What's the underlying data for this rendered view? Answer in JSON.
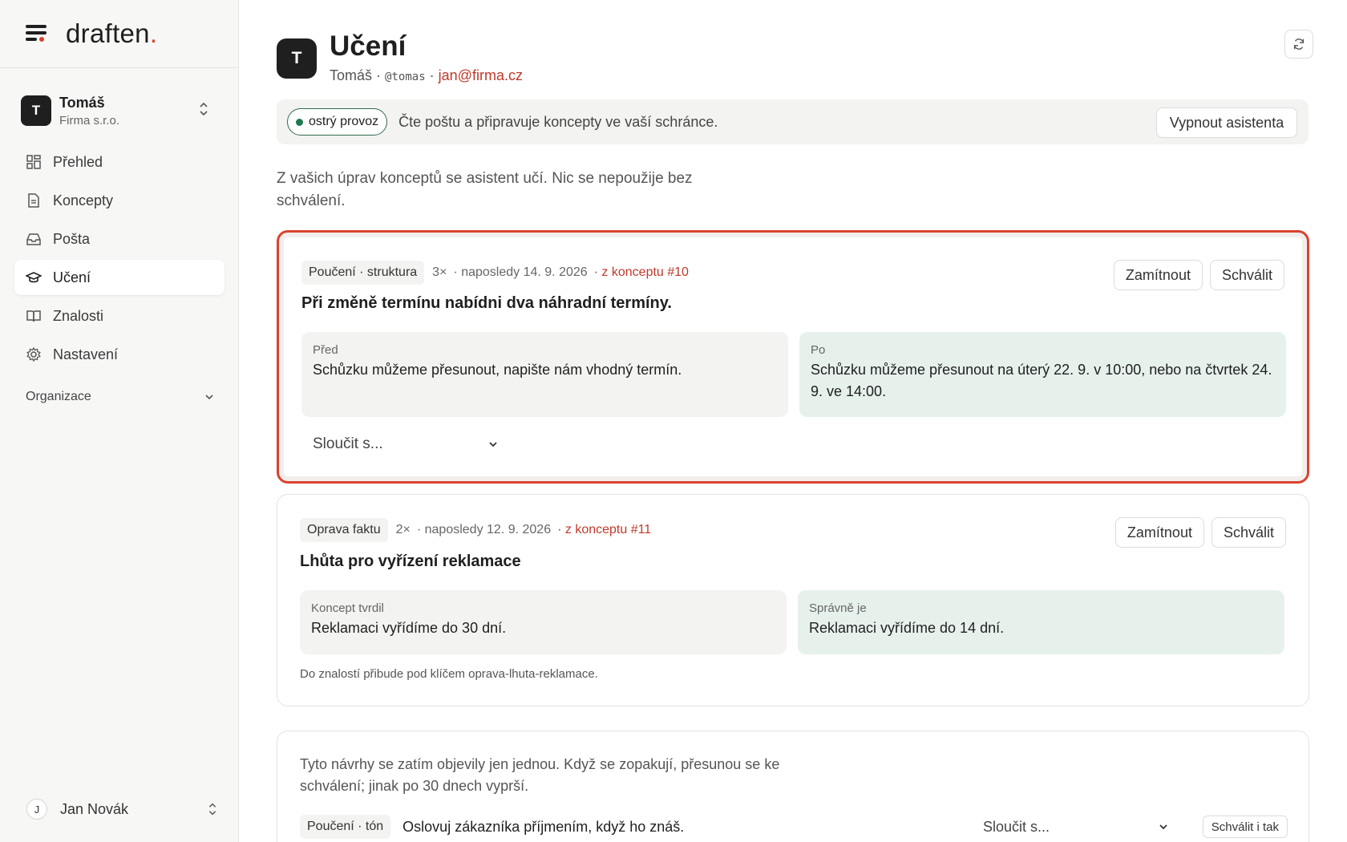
{
  "brand": {
    "name": "draften",
    "dot": "."
  },
  "account": {
    "initial": "T",
    "name": "Tomáš",
    "org": "Firma s.r.o."
  },
  "nav": {
    "items": [
      {
        "label": "Přehled",
        "icon": "grid-icon"
      },
      {
        "label": "Koncepty",
        "icon": "document-icon"
      },
      {
        "label": "Pošta",
        "icon": "inbox-icon"
      },
      {
        "label": "Učení",
        "icon": "graduation-cap-icon",
        "active": true
      },
      {
        "label": "Znalosti",
        "icon": "book-icon"
      },
      {
        "label": "Nastavení",
        "icon": "gear-icon"
      }
    ],
    "org_section": "Organizace"
  },
  "user": {
    "initial": "J",
    "name": "Jan Novák"
  },
  "header": {
    "initial": "T",
    "title": "Učení",
    "name": "Tomáš",
    "separator": "·",
    "handle": "@tomas",
    "email": "jan@firma.cz"
  },
  "status": {
    "pill": "ostrý provoz",
    "text": "Čte poštu a připravuje koncepty ve vaší schránce.",
    "disable_label": "Vypnout asistenta"
  },
  "intro": "Z vašich úprav konceptů se asistent učí. Nic se nepoužije bez schválení.",
  "cards": [
    {
      "tag": "Poučení · struktura",
      "count": "3×",
      "date": "· naposledy 14. 9. 2026",
      "source": "· z konceptu #10",
      "reject_label": "Zamítnout",
      "approve_label": "Schválit",
      "title": "Při změně termínu nabídni dva náhradní termíny.",
      "before_label": "Před",
      "before_text": "Schůzku můžeme přesunout, napište nám vhodný termín.",
      "after_label": "Po",
      "after_text": "Schůzku můžeme přesunout na úterý 22. 9. v 10:00, nebo na čtvrtek 24. 9. ve 14:00.",
      "merge_placeholder": "Sloučit s..."
    },
    {
      "tag": "Oprava faktu",
      "count": "2×",
      "date": "· naposledy 12. 9. 2026",
      "source": "· z konceptu #11",
      "reject_label": "Zamítnout",
      "approve_label": "Schválit",
      "title": "Lhůta pro vyřízení reklamace",
      "before_label": "Koncept tvrdil",
      "before_text": "Reklamaci vyřídíme do 30 dní.",
      "after_label": "Správně je",
      "after_text": "Reklamaci vyřídíme do 14 dní.",
      "note": "Do znalostí přibude pod klíčem oprava-lhuta-reklamace."
    }
  ],
  "pending": {
    "text": "Tyto návrhy se zatím objevily jen jednou. Když se zopakují, přesunou se ke schválení; jinak po 30 dnech vyprší.",
    "tag": "Poučení · tón",
    "item_text": "Oslovuj zákazníka příjmením, když ho znáš.",
    "merge_placeholder": "Sloučit s...",
    "approve_anyway_label": "Schválit i tak"
  },
  "colors": {
    "accent": "#d9432f",
    "link": "#c0392b",
    "live": "#1f7a4d",
    "after_bg": "#e6f1ec"
  }
}
